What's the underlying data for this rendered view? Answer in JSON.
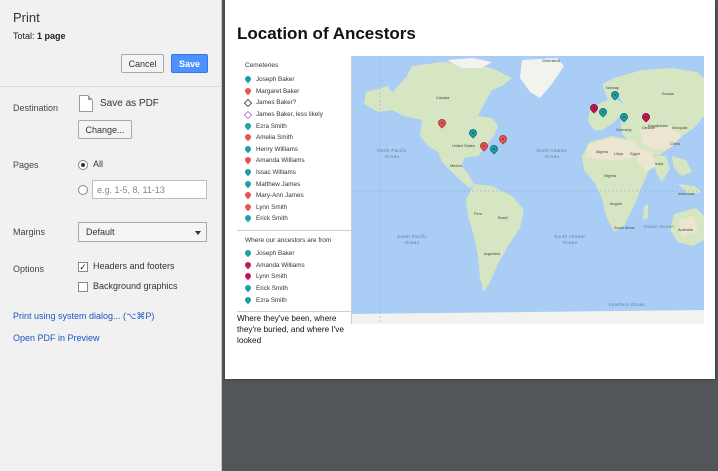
{
  "panel": {
    "title": "Print",
    "total_label": "Total:",
    "total_value": "1 page",
    "cancel_label": "Cancel",
    "save_label": "Save",
    "destination_label": "Destination",
    "destination_name": "Save as PDF",
    "change_label": "Change...",
    "pages_label": "Pages",
    "pages_all_label": "All",
    "pages_range_placeholder": "e.g. 1-5, 8, 11-13",
    "margins_label": "Margins",
    "margins_value": "Default",
    "options_label": "Options",
    "headers_footers_label": "Headers and footers",
    "headers_footers_checked": true,
    "background_graphics_label": "Background graphics",
    "background_graphics_checked": false,
    "system_dialog_link": "Print using system dialog... (⌥⌘P)",
    "open_pdf_link": "Open PDF in Preview"
  },
  "document": {
    "title": "Location of Ancestors",
    "caption": "Where they've been, where they're buried, and where I've looked",
    "legend": {
      "section1_title": "Cemeteries",
      "section1_items": [
        {
          "name": "Joseph Baker",
          "marker": "pin",
          "color": "#1c9fa6"
        },
        {
          "name": "Margaret Baker",
          "marker": "pin",
          "color": "#e8534f"
        },
        {
          "name": "James Baker?",
          "marker": "diamond",
          "color": "#555555"
        },
        {
          "name": "James Baker, less likely",
          "marker": "diamond",
          "color": "#c07ac9"
        },
        {
          "name": "Ezra Smith",
          "marker": "pin",
          "color": "#1c9fa6"
        },
        {
          "name": "Amelia Smith",
          "marker": "pin",
          "color": "#e8534f"
        },
        {
          "name": "Henry Williams",
          "marker": "pin",
          "color": "#1c9fa6"
        },
        {
          "name": "Amanda Williams",
          "marker": "pin",
          "color": "#e8534f"
        },
        {
          "name": "Issac Williams",
          "marker": "pin",
          "color": "#1c9fa6"
        },
        {
          "name": "Matthew James",
          "marker": "pin",
          "color": "#1c9fa6"
        },
        {
          "name": "Mary-Ann James",
          "marker": "pin",
          "color": "#e8534f"
        },
        {
          "name": "Lynn Smith",
          "marker": "pin",
          "color": "#e8534f"
        },
        {
          "name": "Erick Smith",
          "marker": "pin",
          "color": "#1c9fa6"
        }
      ],
      "section2_title": "Where our ancestors are from",
      "section2_items": [
        {
          "name": "Joseph Baker",
          "marker": "pin",
          "color": "#1c9fa6"
        },
        {
          "name": "Amanda Williams",
          "marker": "pin",
          "color": "#c2185b"
        },
        {
          "name": "Lynn Smith",
          "marker": "pin",
          "color": "#c2185b"
        },
        {
          "name": "Erick Smith",
          "marker": "pin",
          "color": "#1c9fa6"
        },
        {
          "name": "Ezra Smith",
          "marker": "pin",
          "color": "#1c9fa6"
        }
      ]
    },
    "map": {
      "ocean_labels": [
        "North Pacific Ocean",
        "North Atlantic Ocean",
        "South Pacific Ocean",
        "South Atlantic Ocean",
        "Indian Ocean",
        "Southern Ocean"
      ],
      "country_labels": [
        "Greenland",
        "Canada",
        "United States",
        "Mexico",
        "Brazil",
        "Peru",
        "Argentina",
        "Germany",
        "Ukraine",
        "Norway",
        "Algeria",
        "Libya",
        "Egypt",
        "Nigeria",
        "Angola",
        "South Africa",
        "Kazakhstan",
        "Mongolia",
        "China",
        "India",
        "Indonesia",
        "Australia",
        "Russia"
      ],
      "colors": {
        "ocean": "#a9cdf5",
        "land": "#d6e6c2",
        "desert": "#ece5cf",
        "ice": "#f2f2ee"
      }
    }
  }
}
